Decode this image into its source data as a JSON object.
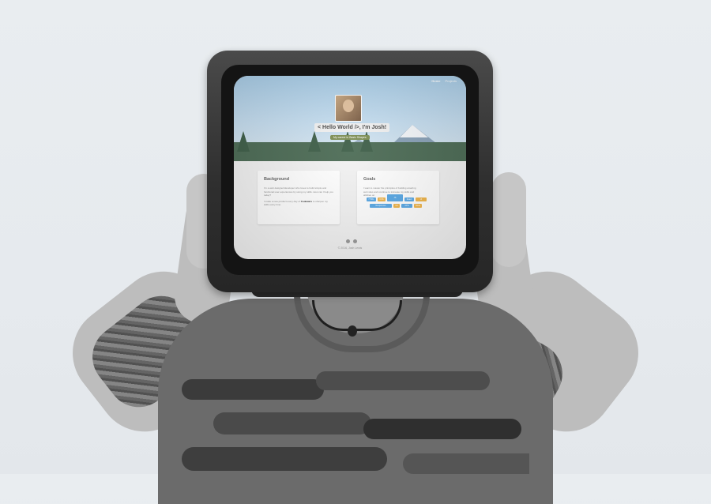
{
  "screen": {
    "nav": {
      "items": [
        "Home",
        "Projects"
      ]
    },
    "hero": {
      "title": "< Hello World />, I'm Josh!",
      "button_label": "My career in Basic Shapes"
    },
    "cards": [
      {
        "title": "Background",
        "text": "I'm a web designer/developer who loves to build simple and functional user experiences by using my skills. How can I help you today?",
        "text2_pre": "I make a new product every day of ",
        "text2_bold": "Codewars",
        "text2_post": " to sharpen my skills every time."
      },
      {
        "title": "Goals",
        "text": "I want to master the principles of building amazing web sites and continue to increase my skills and abilities on:"
      }
    ],
    "skills": [
      {
        "label": "HTML",
        "color": "#5aa9e6"
      },
      {
        "label": "CSS",
        "color": "#f0b64c"
      },
      {
        "label": "JS",
        "color": "#5aa9e6"
      },
      {
        "label": "React",
        "color": "#5aa9e6"
      },
      {
        "label": "UI",
        "color": "#f0b64c"
      },
      {
        "label": "Responsive",
        "color": "#5aa9e6"
      },
      {
        "label": "Git",
        "color": "#f0b64c"
      },
      {
        "label": "APIs",
        "color": "#5aa9e6"
      },
      {
        "label": "Node",
        "color": "#f0b64c"
      }
    ],
    "footer": {
      "icons": [
        "circle-icon",
        "github-icon"
      ],
      "text": "© 2016, Josh Lewis"
    }
  }
}
